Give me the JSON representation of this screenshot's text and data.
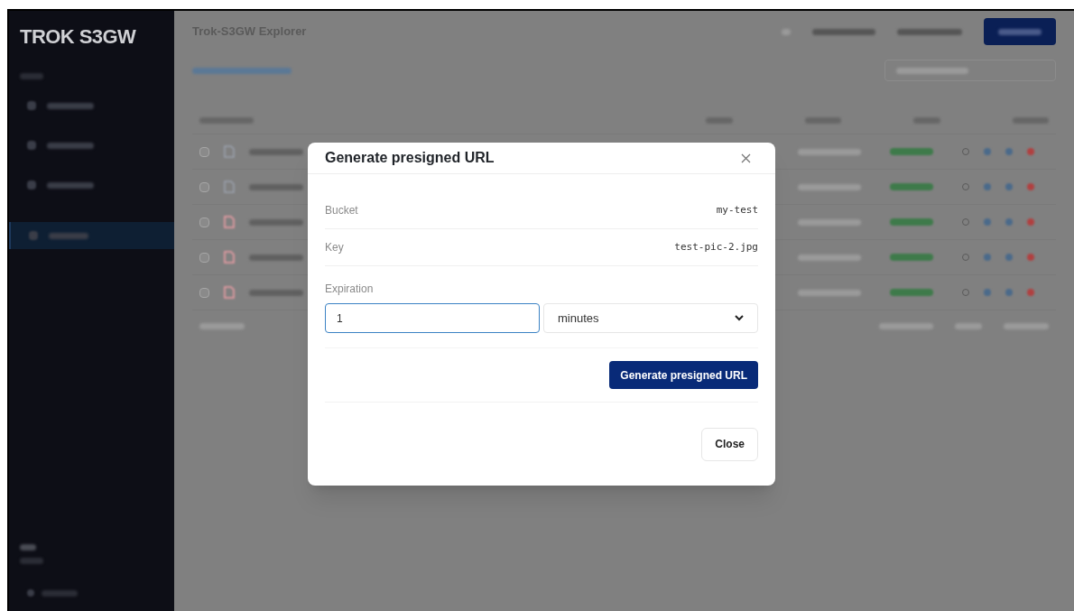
{
  "app": {
    "logo": "TROK S3GW",
    "title": "Trok-S3GW Explorer"
  },
  "nav_items": [
    {
      "selected": false
    },
    {
      "selected": false
    },
    {
      "selected": false
    },
    {
      "selected": true
    }
  ],
  "rows": [
    {
      "kind": "document",
      "checked": false
    },
    {
      "kind": "document",
      "checked": false
    },
    {
      "kind": "image",
      "checked": false
    },
    {
      "kind": "image",
      "checked": false
    },
    {
      "kind": "image",
      "checked": false
    }
  ],
  "dialog": {
    "title": "Generate presigned URL",
    "fields": [
      {
        "label": "Bucket",
        "value": "my-test"
      },
      {
        "label": "Key",
        "value": "test-pic-2.jpg"
      }
    ],
    "expiration": {
      "label": "Expiration",
      "value": "1",
      "unit": "minutes"
    },
    "primary_button": "Generate presigned URL",
    "close_button": "Close"
  }
}
